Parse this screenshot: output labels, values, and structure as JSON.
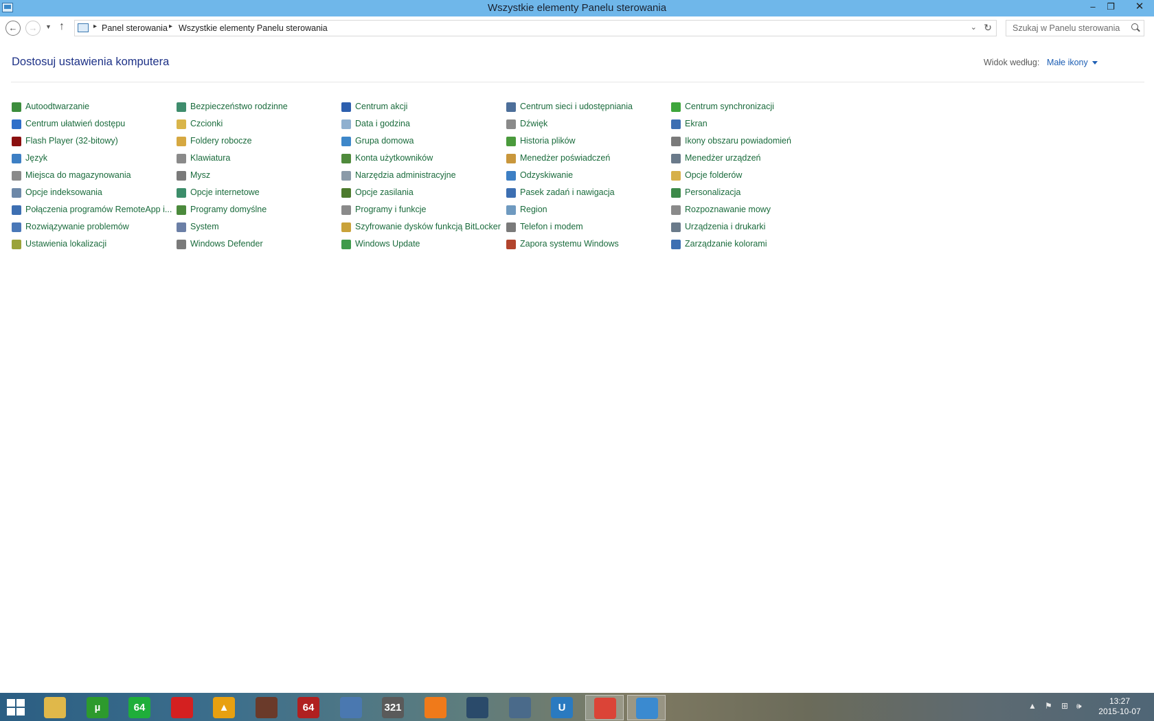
{
  "window": {
    "title": "Wszystkie elementy Panelu sterowania",
    "min_glyph": "–",
    "max_glyph": "❐",
    "close_glyph": "✕"
  },
  "address": {
    "back_glyph": "←",
    "forward_glyph": "→",
    "recent_glyph": "▼",
    "up_glyph": "↑",
    "sep": "▸",
    "crumbs": [
      "Panel sterowania",
      "Wszystkie elementy Panelu sterowania"
    ],
    "dropdown_glyph": "⌄",
    "refresh_glyph": "↻"
  },
  "search": {
    "placeholder": "Szukaj w Panelu sterowania",
    "value": ""
  },
  "header": {
    "title": "Dostosuj ustawienia komputera",
    "viewby_label": "Widok według:",
    "viewby_value": "Małe ikony"
  },
  "columns": [
    [
      {
        "label": "Autoodtwarzanie",
        "icon": "autoplay-icon",
        "color": "#3c8d3c"
      },
      {
        "label": "Centrum ułatwień dostępu",
        "icon": "ease-of-access-icon",
        "color": "#2e6fc9"
      },
      {
        "label": "Flash Player (32-bitowy)",
        "icon": "flash-icon",
        "color": "#8b1010"
      },
      {
        "label": "Język",
        "icon": "language-icon",
        "color": "#3d7fc4"
      },
      {
        "label": "Miejsca do magazynowania",
        "icon": "storage-spaces-icon",
        "color": "#8a8a8a"
      },
      {
        "label": "Opcje indeksowania",
        "icon": "indexing-icon",
        "color": "#6d88a8"
      },
      {
        "label": "Połączenia programów RemoteApp i...",
        "icon": "remoteapp-icon",
        "color": "#3d6fb2"
      },
      {
        "label": "Rozwiązywanie problemów",
        "icon": "troubleshooting-icon",
        "color": "#4a78b8"
      },
      {
        "label": "Ustawienia lokalizacji",
        "icon": "location-settings-icon",
        "color": "#9aa33a"
      }
    ],
    [
      {
        "label": "Bezpieczeństwo rodzinne",
        "icon": "family-safety-icon",
        "color": "#3f8d6d"
      },
      {
        "label": "Czcionki",
        "icon": "fonts-icon",
        "color": "#d9b54a"
      },
      {
        "label": "Foldery robocze",
        "icon": "work-folders-icon",
        "color": "#d6a841"
      },
      {
        "label": "Klawiatura",
        "icon": "keyboard-icon",
        "color": "#8a8a8a"
      },
      {
        "label": "Mysz",
        "icon": "mouse-icon",
        "color": "#7a7a7a"
      },
      {
        "label": "Opcje internetowe",
        "icon": "internet-options-icon",
        "color": "#3c8d6a"
      },
      {
        "label": "Programy domyślne",
        "icon": "default-programs-icon",
        "color": "#4b8a3c"
      },
      {
        "label": "System",
        "icon": "system-icon",
        "color": "#6b7fa6"
      },
      {
        "label": "Windows Defender",
        "icon": "windows-defender-icon",
        "color": "#7a7a7a"
      }
    ],
    [
      {
        "label": "Centrum akcji",
        "icon": "action-center-icon",
        "color": "#2d5fae"
      },
      {
        "label": "Data i godzina",
        "icon": "date-time-icon",
        "color": "#8fb0cf"
      },
      {
        "label": "Grupa domowa",
        "icon": "homegroup-icon",
        "color": "#3d87c9"
      },
      {
        "label": "Konta użytkowników",
        "icon": "user-accounts-icon",
        "color": "#4f8a3c"
      },
      {
        "label": "Narzędzia administracyjne",
        "icon": "admin-tools-icon",
        "color": "#8a9aa8"
      },
      {
        "label": "Opcje zasilania",
        "icon": "power-options-icon",
        "color": "#4c7a2d"
      },
      {
        "label": "Programy i funkcje",
        "icon": "programs-features-icon",
        "color": "#8a8a8a"
      },
      {
        "label": "Szyfrowanie dysków funkcją BitLocker",
        "icon": "bitlocker-icon",
        "color": "#c9a23a"
      },
      {
        "label": "Windows Update",
        "icon": "windows-update-icon",
        "color": "#3e9a4a"
      }
    ],
    [
      {
        "label": "Centrum sieci i udostępniania",
        "icon": "network-center-icon",
        "color": "#4d6f9a"
      },
      {
        "label": "Dźwięk",
        "icon": "sound-icon",
        "color": "#8a8a8a"
      },
      {
        "label": "Historia plików",
        "icon": "file-history-icon",
        "color": "#4a9a3c"
      },
      {
        "label": "Menedżer poświadczeń",
        "icon": "credential-manager-icon",
        "color": "#c9973c"
      },
      {
        "label": "Odzyskiwanie",
        "icon": "recovery-icon",
        "color": "#3d7fc4"
      },
      {
        "label": "Pasek zadań i nawigacja",
        "icon": "taskbar-navigation-icon",
        "color": "#3d6fb2"
      },
      {
        "label": "Region",
        "icon": "region-icon",
        "color": "#6f9ac0"
      },
      {
        "label": "Telefon i modem",
        "icon": "phone-modem-icon",
        "color": "#7a7a7a"
      },
      {
        "label": "Zapora systemu Windows",
        "icon": "firewall-icon",
        "color": "#b2442d"
      }
    ],
    [
      {
        "label": "Centrum synchronizacji",
        "icon": "sync-center-icon",
        "color": "#3ea63c"
      },
      {
        "label": "Ekran",
        "icon": "display-icon",
        "color": "#3d6fb2"
      },
      {
        "label": "Ikony obszaru powiadomień",
        "icon": "notification-icons-icon",
        "color": "#7a7a7a"
      },
      {
        "label": "Menedżer urządzeń",
        "icon": "device-manager-icon",
        "color": "#6a7a8a"
      },
      {
        "label": "Opcje folderów",
        "icon": "folder-options-icon",
        "color": "#d6b04a"
      },
      {
        "label": "Personalizacja",
        "icon": "personalization-icon",
        "color": "#3d8a4a"
      },
      {
        "label": "Rozpoznawanie mowy",
        "icon": "speech-recognition-icon",
        "color": "#8a8a8a"
      },
      {
        "label": "Urządzenia i drukarki",
        "icon": "devices-printers-icon",
        "color": "#6a7a8a"
      },
      {
        "label": "Zarządzanie kolorami",
        "icon": "color-management-icon",
        "color": "#3d6fb2"
      }
    ]
  ],
  "taskbar": {
    "apps": [
      {
        "name": "file-explorer",
        "icon": "file-explorer-icon",
        "glyph": "",
        "color": "#e0b84a",
        "active": false
      },
      {
        "name": "utorrent",
        "icon": "utorrent-icon",
        "glyph": "µ",
        "color": "#2d9a2d",
        "active": false
      },
      {
        "name": "app-64",
        "icon": "app-64-icon",
        "glyph": "64",
        "color": "#1fae3a",
        "active": false
      },
      {
        "name": "recorder",
        "icon": "record-icon",
        "glyph": "",
        "color": "#d42020",
        "active": false
      },
      {
        "name": "aimp",
        "icon": "aimp-icon",
        "glyph": "▲",
        "color": "#e8a010",
        "active": false
      },
      {
        "name": "gog",
        "icon": "gog-icon",
        "glyph": "",
        "color": "#6a3a2a",
        "active": false
      },
      {
        "name": "app-64-red",
        "icon": "app-64-red-icon",
        "glyph": "64",
        "color": "#b02020",
        "active": false
      },
      {
        "name": "thunderbird",
        "icon": "thunderbird-icon",
        "glyph": "",
        "color": "#4a78b0",
        "active": false
      },
      {
        "name": "media-player-classic",
        "icon": "media-player-icon",
        "glyph": "321",
        "color": "#5a5a5a",
        "active": false
      },
      {
        "name": "origin",
        "icon": "origin-icon",
        "glyph": "",
        "color": "#f07a1a",
        "active": false
      },
      {
        "name": "steam",
        "icon": "steam-icon",
        "glyph": "",
        "color": "#2a4a6a",
        "active": false
      },
      {
        "name": "app-moon",
        "icon": "moon-app-icon",
        "glyph": "",
        "color": "#4a6a8a",
        "active": false
      },
      {
        "name": "uplay",
        "icon": "uplay-icon",
        "glyph": "U",
        "color": "#2a7ac0",
        "active": false
      },
      {
        "name": "chrome",
        "icon": "chrome-icon",
        "glyph": "",
        "color": "#db4437",
        "active": true
      },
      {
        "name": "control-panel",
        "icon": "control-panel-icon",
        "glyph": "",
        "color": "#3a8ad0",
        "active": true
      }
    ],
    "time": "13:27",
    "date": "2015-10-07",
    "tray": {
      "show_hidden_glyph": "▲",
      "flag_glyph": "⚑",
      "network_glyph": "⊞",
      "volume_glyph": "🕪"
    }
  }
}
